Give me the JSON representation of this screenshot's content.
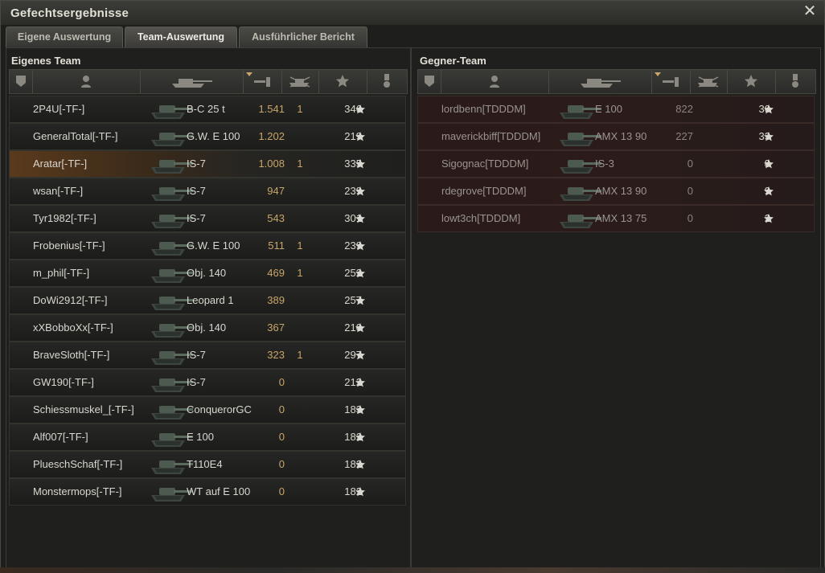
{
  "window": {
    "title": "Gefechtsergebnisse"
  },
  "tabs": [
    {
      "label": "Eigene Auswertung"
    },
    {
      "label": "Team-Auswertung"
    },
    {
      "label": "Ausführlicher Bericht"
    }
  ],
  "active_tab": "Team-Auswertung",
  "own_team": {
    "title": "Eigenes Team",
    "highlighted_player": "Aratar[-TF-]",
    "rows": [
      {
        "player": "2P4U[-TF-]",
        "tank": "B-C 25 t",
        "xp": "1.541",
        "kills": "1",
        "score": "346"
      },
      {
        "player": "GeneralTotal[-TF-]",
        "tank": "G.W. E 100",
        "xp": "1.202",
        "kills": "",
        "score": "219"
      },
      {
        "player": "Aratar[-TF-]",
        "tank": "IS-7",
        "xp": "1.008",
        "kills": "1",
        "score": "335"
      },
      {
        "player": "wsan[-TF-]",
        "tank": "IS-7",
        "xp": "947",
        "kills": "",
        "score": "239"
      },
      {
        "player": "Tyr1982[-TF-]",
        "tank": "IS-7",
        "xp": "543",
        "kills": "",
        "score": "301"
      },
      {
        "player": "Frobenius[-TF-]",
        "tank": "G.W. E 100",
        "xp": "511",
        "kills": "1",
        "score": "239"
      },
      {
        "player": "m_phil[-TF-]",
        "tank": "Obj. 140",
        "xp": "469",
        "kills": "1",
        "score": "252"
      },
      {
        "player": "DoWi2912[-TF-]",
        "tank": "Leopard 1",
        "xp": "389",
        "kills": "",
        "score": "257"
      },
      {
        "player": "xXBobboXx[-TF-]",
        "tank": "Obj. 140",
        "xp": "367",
        "kills": "",
        "score": "210"
      },
      {
        "player": "BraveSloth[-TF-]",
        "tank": "IS-7",
        "xp": "323",
        "kills": "1",
        "score": "297"
      },
      {
        "player": "GW190[-TF-]",
        "tank": "IS-7",
        "xp": "0",
        "kills": "",
        "score": "212"
      },
      {
        "player": "Schiessmuskel_[-TF-]",
        "tank": "ConquerorGC",
        "xp": "0",
        "kills": "",
        "score": "183"
      },
      {
        "player": "Alf007[-TF-]",
        "tank": "E 100",
        "xp": "0",
        "kills": "",
        "score": "182"
      },
      {
        "player": "PlueschSchaf[-TF-]",
        "tank": "T110E4",
        "xp": "0",
        "kills": "",
        "score": "182"
      },
      {
        "player": "Monstermops[-TF-]",
        "tank": "WT auf E 100",
        "xp": "0",
        "kills": "",
        "score": "182"
      }
    ]
  },
  "enemy_team": {
    "title": "Gegner-Team",
    "rows": [
      {
        "player": "lordbenn[TDDDM]",
        "tank": "E 100",
        "xp": "822",
        "kills": "",
        "score": "30"
      },
      {
        "player": "maverickbiff[TDDDM]",
        "tank": "AMX 13 90",
        "xp": "227",
        "kills": "",
        "score": "33"
      },
      {
        "player": "Sigognac[TDDDM]",
        "tank": "IS-3",
        "xp": "0",
        "kills": "",
        "score": "8"
      },
      {
        "player": "rdegrove[TDDDM]",
        "tank": "AMX 13 90",
        "xp": "0",
        "kills": "",
        "score": "9"
      },
      {
        "player": "lowt3ch[TDDDM]",
        "tank": "AMX 13 75",
        "xp": "0",
        "kills": "",
        "score": "2"
      }
    ]
  },
  "icons": {
    "close": "close-icon",
    "columns": [
      "rank-icon",
      "player-icon",
      "tank-icon",
      "damage-icon",
      "kills-icon",
      "score-star-icon",
      "medal-icon"
    ]
  },
  "colors": {
    "highlight": "#5a3a1c",
    "gold": "#c9a56a",
    "enemy_row": "#2b1c1b"
  }
}
